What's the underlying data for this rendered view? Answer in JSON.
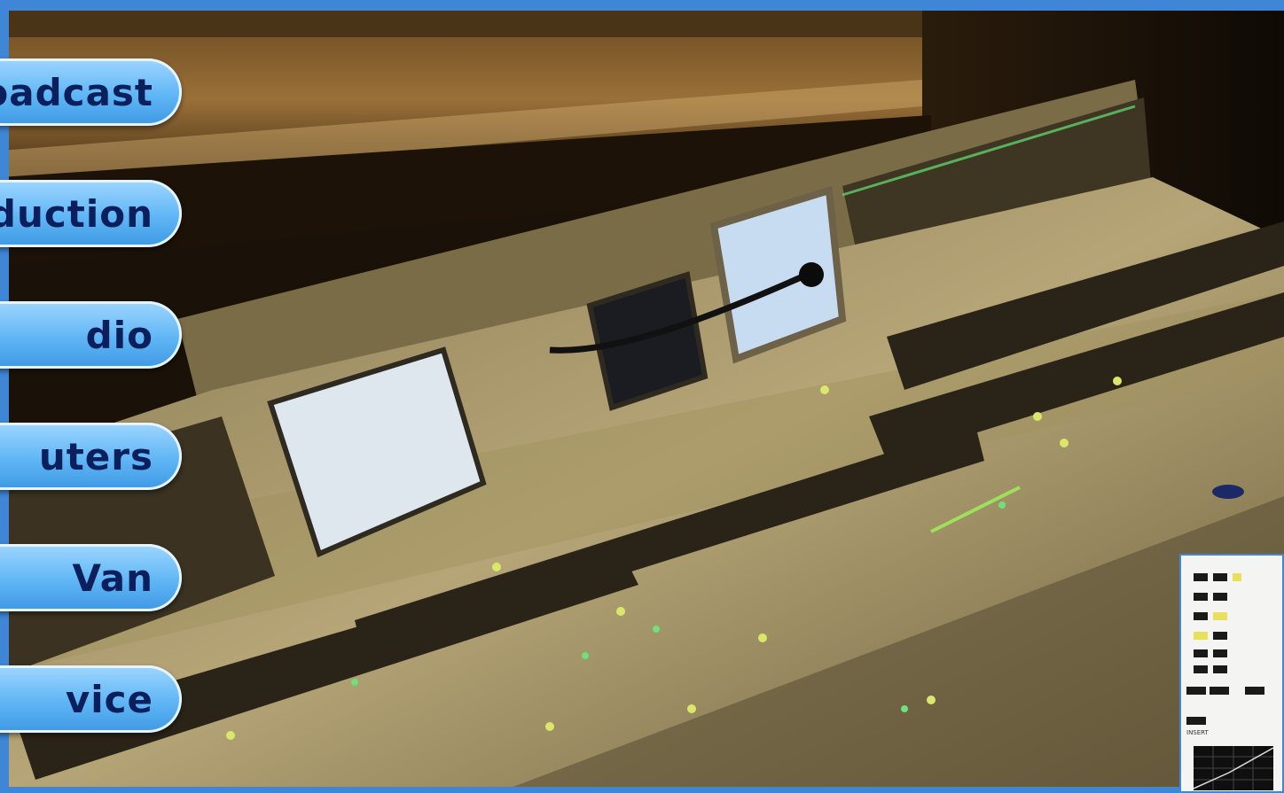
{
  "menu": {
    "items": [
      {
        "label": "oadcast"
      },
      {
        "label": "duction"
      },
      {
        "label": "dio"
      },
      {
        "label": "uters"
      },
      {
        "label": "Van"
      },
      {
        "label": "vice"
      }
    ]
  },
  "inset": {
    "label": "INSERT"
  },
  "colors": {
    "accent": "#3f86d6",
    "pill_text": "#0b1f5c"
  }
}
